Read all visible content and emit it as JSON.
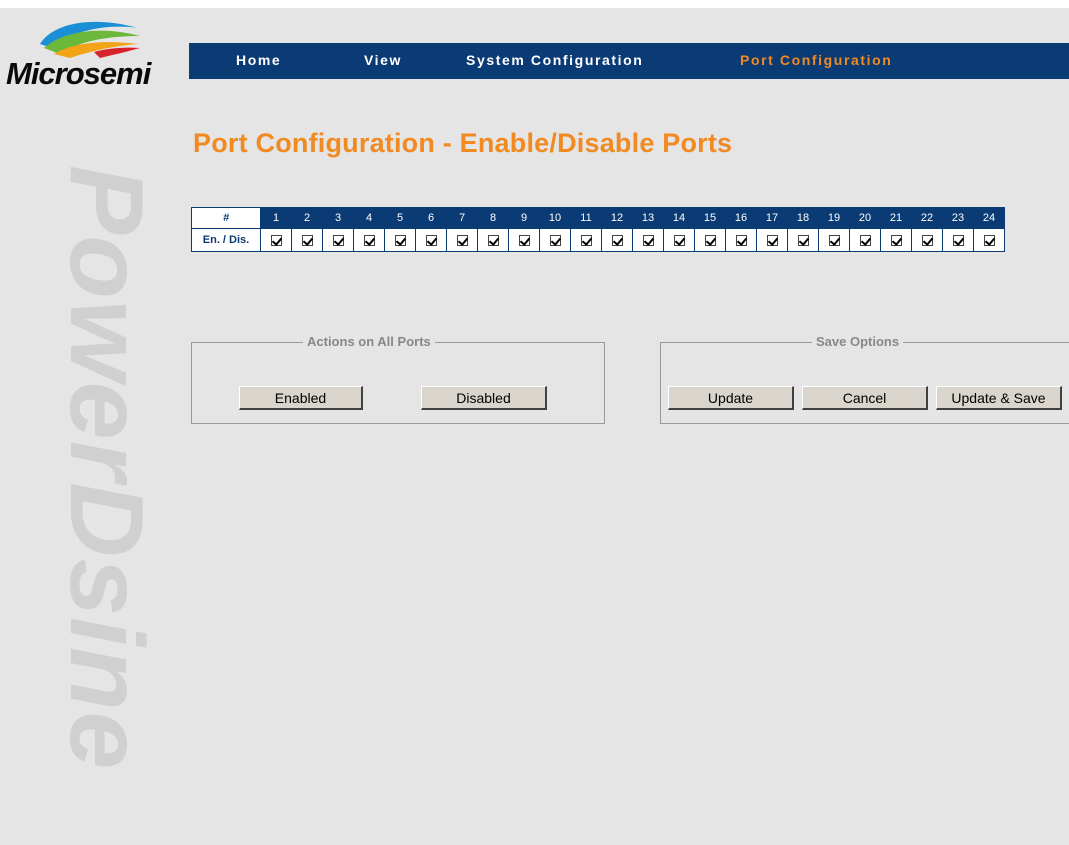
{
  "brand": {
    "logo_text": "Microsemi",
    "watermark": "PowerDsine"
  },
  "nav": {
    "items": [
      "Home",
      "View",
      "System Configuration",
      "Port Configuration"
    ],
    "active": "Port Configuration"
  },
  "page": {
    "title": "Port Configuration - Enable/Disable Ports"
  },
  "port_table": {
    "header_label": "#",
    "row_label": "En. / Dis.",
    "ports": [
      "1",
      "2",
      "3",
      "4",
      "5",
      "6",
      "7",
      "8",
      "9",
      "10",
      "11",
      "12",
      "13",
      "14",
      "15",
      "16",
      "17",
      "18",
      "19",
      "20",
      "21",
      "22",
      "23",
      "24"
    ],
    "enabled": [
      true,
      true,
      true,
      true,
      true,
      true,
      true,
      true,
      true,
      true,
      true,
      true,
      true,
      true,
      true,
      true,
      true,
      true,
      true,
      true,
      true,
      true,
      true,
      true
    ]
  },
  "actions_group": {
    "legend": "Actions on All Ports",
    "enabled_label": "Enabled",
    "disabled_label": "Disabled"
  },
  "save_group": {
    "legend": "Save Options",
    "update_label": "Update",
    "cancel_label": "Cancel",
    "update_save_label": "Update & Save"
  },
  "colors": {
    "nav_bg": "#0b3b74",
    "accent": "#f28a22",
    "background": "#e5e5e5"
  }
}
